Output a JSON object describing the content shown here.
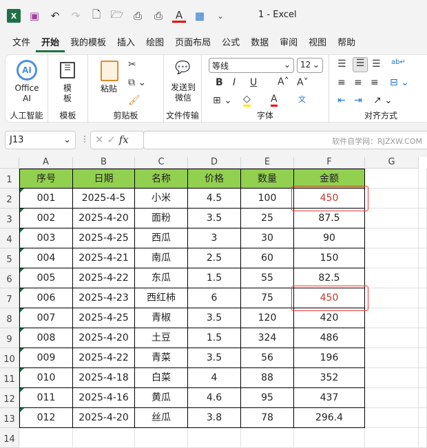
{
  "app": {
    "title": "1  -  Excel"
  },
  "menu": [
    "文件",
    "开始",
    "我的模板",
    "插入",
    "绘图",
    "页面布局",
    "公式",
    "数据",
    "审阅",
    "视图",
    "帮助"
  ],
  "ribbon": {
    "office_ai": "Office AI",
    "ai_group": "人工智能",
    "template_btn": "模板",
    "template_group": "模板",
    "paste": "粘贴",
    "clipboard_group": "剪贴板",
    "send_wechat": "发送到微信",
    "file_transfer_group": "文件传输",
    "font_name": "等线",
    "font_size": "12",
    "font_group": "字体",
    "bold": "B",
    "italic": "I",
    "underline": "U",
    "align_group": "对齐方式"
  },
  "formula_bar": {
    "name_box": "J13",
    "fx": "fx",
    "watermark": "软件自学网：RJZXW.COM"
  },
  "columns": [
    "A",
    "B",
    "C",
    "D",
    "E",
    "F",
    "G"
  ],
  "rows": [
    "1",
    "2",
    "3",
    "4",
    "5",
    "6",
    "7",
    "8",
    "9",
    "10",
    "11",
    "12",
    "13",
    "14"
  ],
  "table": {
    "headers": [
      "序号",
      "日期",
      "名称",
      "价格",
      "数量",
      "金额"
    ],
    "rows": [
      [
        "001",
        "2025-4-5",
        "小米",
        "4.5",
        "100",
        "450"
      ],
      [
        "002",
        "2025-4-20",
        "面粉",
        "3.5",
        "25",
        "87.5"
      ],
      [
        "003",
        "2025-4-25",
        "西瓜",
        "3",
        "30",
        "90"
      ],
      [
        "004",
        "2025-4-21",
        "南瓜",
        "2.5",
        "60",
        "150"
      ],
      [
        "005",
        "2025-4-22",
        "东瓜",
        "1.5",
        "55",
        "82.5"
      ],
      [
        "006",
        "2025-4-23",
        "西红柿",
        "6",
        "75",
        "450"
      ],
      [
        "007",
        "2025-4-25",
        "青椒",
        "3.5",
        "120",
        "420"
      ],
      [
        "008",
        "2025-4-20",
        "土豆",
        "1.5",
        "324",
        "486"
      ],
      [
        "009",
        "2025-4-22",
        "青菜",
        "3.5",
        "56",
        "196"
      ],
      [
        "010",
        "2025-4-18",
        "白菜",
        "4",
        "88",
        "352"
      ],
      [
        "011",
        "2025-4-16",
        "黄瓜",
        "4.6",
        "95",
        "437"
      ],
      [
        "012",
        "2025-4-20",
        "丝瓜",
        "3.8",
        "78",
        "296.4"
      ]
    ],
    "highlight_rows": [
      0,
      5
    ],
    "highlight_color": "#c0392b"
  },
  "colors": {
    "header_fill": "#92d050",
    "accent": "#1e7145"
  }
}
